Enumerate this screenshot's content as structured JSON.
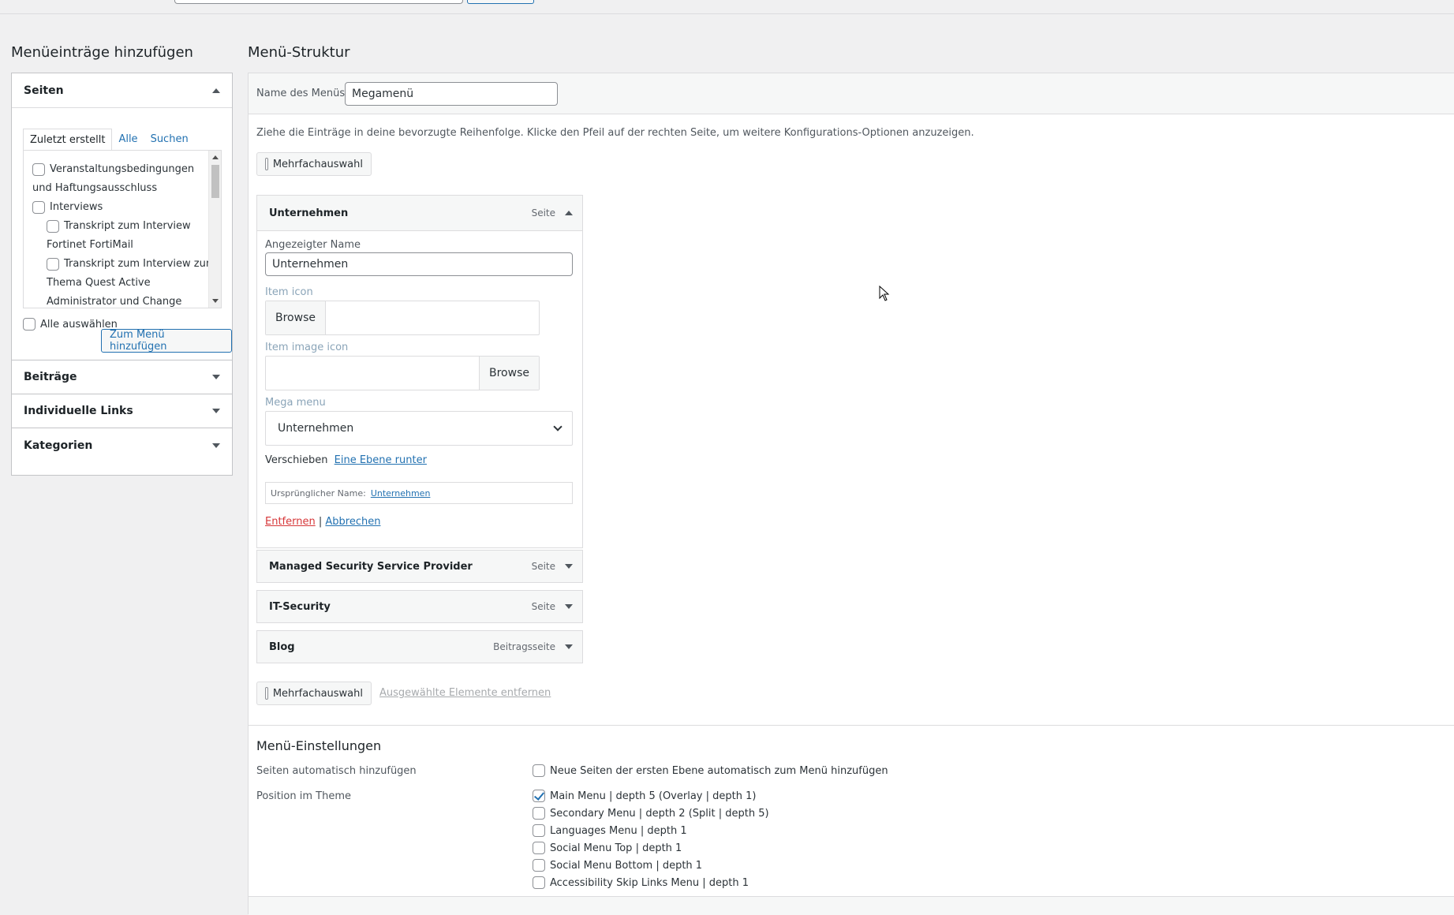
{
  "left": {
    "title": "Menüeinträge hinzufügen",
    "pages_section": {
      "title": "Seiten",
      "tabs": [
        "Zuletzt erstellt",
        "Alle",
        "Suchen"
      ],
      "items": [
        {
          "label_line1": "Veranstaltungsbedingungen",
          "label_line2": "und Haftungsausschluss"
        },
        {
          "label_line1": "Interviews"
        },
        {
          "label_line1": "Transkript zum Interview",
          "label_line2": "Fortinet FortiMail"
        },
        {
          "label_line1": "Transkript zum Interview zum",
          "label_line2": "Thema Quest Active",
          "label_line3": "Administrator und Change"
        }
      ],
      "select_all": "Alle auswählen",
      "add_button": "Zum Menü hinzufügen"
    },
    "sections": [
      "Beiträge",
      "Individuelle Links",
      "Kategorien"
    ]
  },
  "right": {
    "title": "Menü-Struktur",
    "menu_name_label": "Name des Menüs",
    "menu_name_value": "Megamenü",
    "instructions": "Ziehe die Einträge in deine bevorzugte Reihenfolge. Klicke den Pfeil auf der rechten Seite, um weitere Konfigurations-Optionen anzuzeigen.",
    "bulk_select": "Mehrfachauswahl",
    "remove_selected": "Ausgewählte Elemente entfernen",
    "open_item": {
      "title": "Unternehmen",
      "type": "Seite",
      "display_name_label": "Angezeigter Name",
      "display_name_value": "Unternehmen",
      "item_icon_label": "Item icon",
      "item_image_icon_label": "Item image icon",
      "browse_label": "Browse",
      "mega_menu_label": "Mega menu",
      "mega_menu_value": "Unternehmen",
      "move_label": "Verschieben",
      "move_link": "Eine Ebene runter",
      "original_name_label": "Ursprünglicher Name:",
      "original_name_link": "Unternehmen",
      "remove_link": "Entfernen",
      "separator": "|",
      "cancel_link": "Abbrechen"
    },
    "items": [
      {
        "title": "Managed Security Service Provider",
        "type": "Seite"
      },
      {
        "title": "IT-Security",
        "type": "Seite"
      },
      {
        "title": "Blog",
        "type": "Beitragsseite"
      }
    ],
    "settings": {
      "title": "Menü-Einstellungen",
      "auto_add_label": "Seiten automatisch hinzufügen",
      "auto_add_option": "Neue Seiten der ersten Ebene automatisch zum Menü hinzufügen",
      "position_label": "Position im Theme",
      "locations": [
        {
          "label": "Main Menu | depth 5 (Overlay | depth 1)",
          "checked": true
        },
        {
          "label": "Secondary Menu | depth 2 (Split | depth 5)",
          "checked": false
        },
        {
          "label": "Languages Menu | depth 1",
          "checked": false
        },
        {
          "label": "Social Menu Top | depth 1",
          "checked": false
        },
        {
          "label": "Social Menu Bottom | depth 1",
          "checked": false
        },
        {
          "label": "Accessibility Skip Links Menu | depth 1",
          "checked": false
        }
      ]
    }
  }
}
